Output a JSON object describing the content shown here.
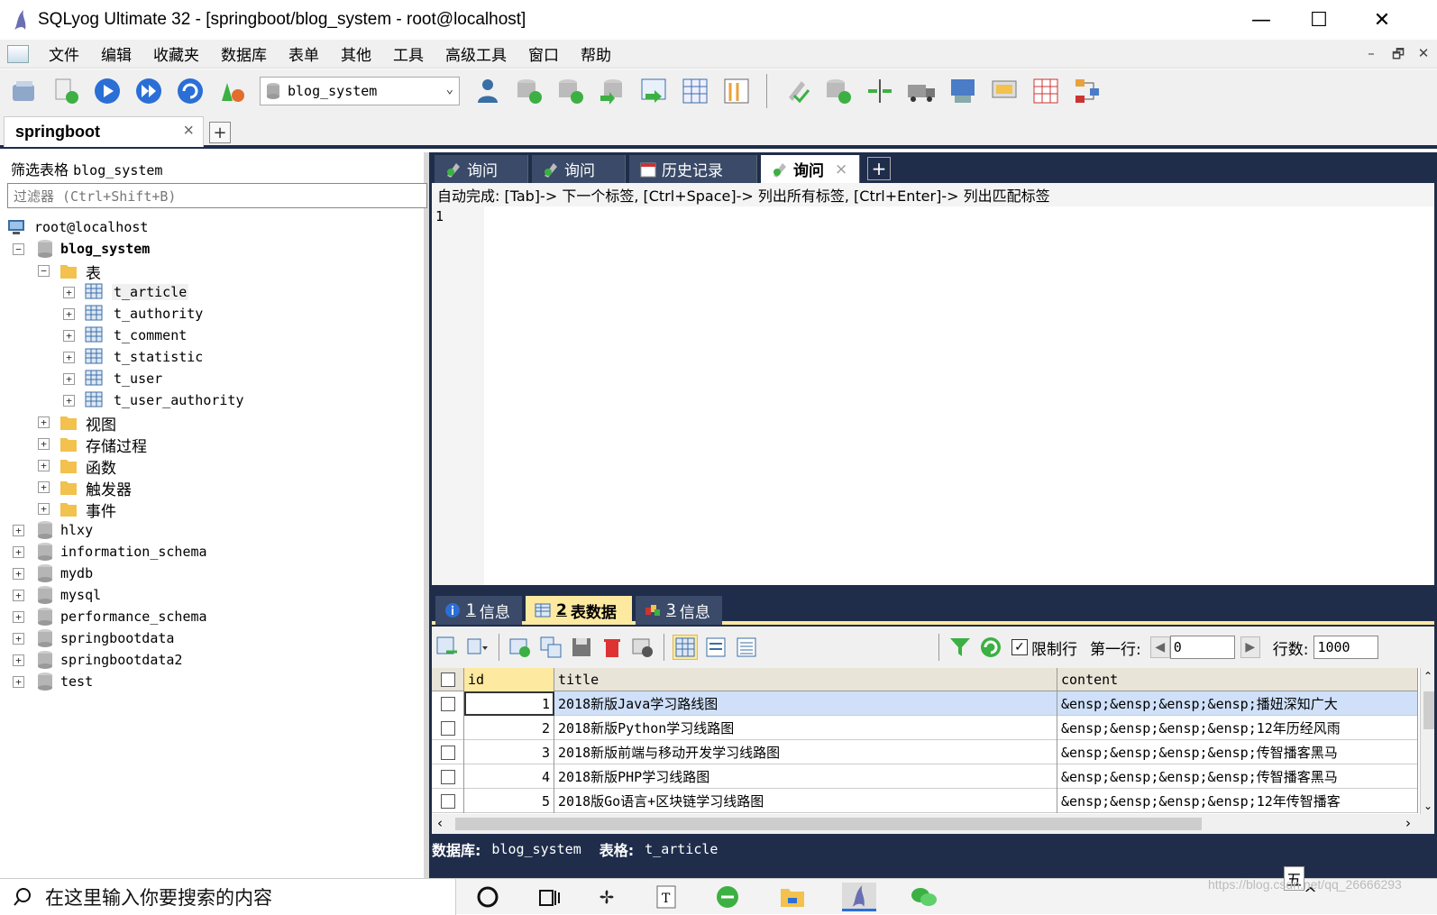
{
  "window": {
    "title": "SQLyog Ultimate 32 - [springboot/blog_system - root@localhost]",
    "controls": {
      "minimize": "—",
      "maximize": "☐",
      "close": "✕"
    }
  },
  "menubar": {
    "items": [
      "文件",
      "编辑",
      "收藏夹",
      "数据库",
      "表单",
      "其他",
      "工具",
      "高级工具",
      "窗口",
      "帮助"
    ],
    "mdi": [
      "–",
      "🗗",
      "✕"
    ]
  },
  "toolbar": {
    "db_selected": "blog_system"
  },
  "connection_tabs": {
    "active": "springboot",
    "close": "×",
    "add": "+"
  },
  "object_browser": {
    "filter_label": "筛选表格",
    "filter_db": "blog_system",
    "filter_placeholder": "过滤器 (Ctrl+Shift+B)",
    "server": "root@localhost",
    "current_db": "blog_system",
    "tables_folder": "表",
    "tables": [
      "t_article",
      "t_authority",
      "t_comment",
      "t_statistic",
      "t_user",
      "t_user_authority"
    ],
    "folders": [
      "视图",
      "存储过程",
      "函数",
      "触发器",
      "事件"
    ],
    "databases": [
      "hlxy",
      "information_schema",
      "mydb",
      "mysql",
      "performance_schema",
      "springbootdata",
      "springbootdata2",
      "test"
    ]
  },
  "query_tabs": {
    "tab1": "询问",
    "tab2": "询问",
    "tab3": "历史记录",
    "tab4": "询问",
    "close": "×",
    "add": "+"
  },
  "editor": {
    "autocomplete_hint": "自动完成: [Tab]-> 下一个标签, [Ctrl+Space]-> 列出所有标签, [Ctrl+Enter]-> 列出匹配标签",
    "line_number": "1"
  },
  "result_tabs": {
    "tab1_num": "1",
    "tab1_label": "信息",
    "tab2_num": "2",
    "tab2_label": "表数据",
    "tab3_num": "3",
    "tab3_label": "信息"
  },
  "result_toolbar": {
    "limit_label": "限制行",
    "limit_checked": true,
    "first_row_label": "第一行:",
    "first_row_value": "0",
    "row_count_label": "行数:",
    "row_count_value": "1000"
  },
  "grid": {
    "columns": [
      "id",
      "title",
      "content"
    ],
    "rows": [
      {
        "id": "1",
        "title": "2018新版Java学习路线图",
        "content": "&ensp;&ensp;&ensp;&ensp;播妞深知广大"
      },
      {
        "id": "2",
        "title": "2018新版Python学习线路图",
        "content": "&ensp;&ensp;&ensp;&ensp;12年历经风雨"
      },
      {
        "id": "3",
        "title": "2018新版前端与移动开发学习线路图",
        "content": "&ensp;&ensp;&ensp;&ensp;传智播客黑马"
      },
      {
        "id": "4",
        "title": "2018新版PHP学习线路图",
        "content": "&ensp;&ensp;&ensp;&ensp;传智播客黑马"
      },
      {
        "id": "5",
        "title": "2018版Go语言+区块链学习线路图",
        "content": "&ensp;&ensp;&ensp;&ensp;12年传智播客"
      }
    ]
  },
  "statusbar": {
    "db_label": "数据库:",
    "db_value": "blog_system",
    "table_label": "表格:",
    "table_value": "t_article"
  },
  "taskbar": {
    "search_placeholder": "在这里输入你要搜索的内容",
    "ime": "五",
    "watermark": "https://blog.csdn.net/qq_26666293"
  },
  "colors": {
    "dark_panel": "#1f2d4b",
    "result_tab_active": "#fde9a0",
    "selected_row": "#cfe0f8"
  }
}
